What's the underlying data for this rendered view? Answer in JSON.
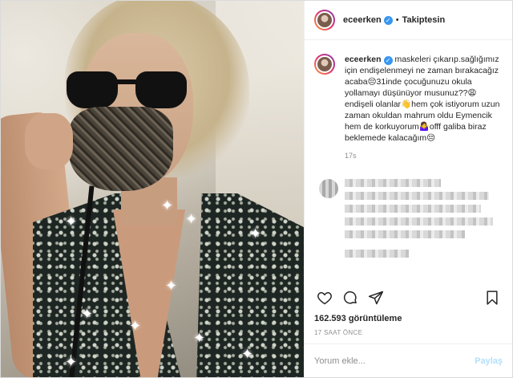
{
  "post": {
    "username": "eceerken",
    "separator": "•",
    "follow_label": "Takiptesin",
    "caption": "maskeleri çıkarıp.sağlığımız için endişelenmeyi ne zaman bırakacağız acaba😔31inde çocuğunuzu okula yollamayı düşünüyor musunuz??😩endişeli olanlar👋hem çok istiyorum uzun zaman okuldan mahrum oldu Eymencik hem de korkuyorum🤷‍♀️offf galiba biraz beklemede kalacağım😔",
    "caption_time": "17s",
    "views": "162.593 görüntüleme",
    "posted_ago": "17 SAAT ÖNCE",
    "comment_placeholder": "Yorum ekle...",
    "post_button": "Paylaş"
  },
  "icons": [
    "verified-icon",
    "heart-icon",
    "comment-icon",
    "share-icon",
    "bookmark-icon",
    "sparkle-icon"
  ],
  "colors": {
    "verified": "#3897f0",
    "post_disabled": "#b2dffc",
    "muted": "#8e8e8e",
    "text": "#262626"
  }
}
